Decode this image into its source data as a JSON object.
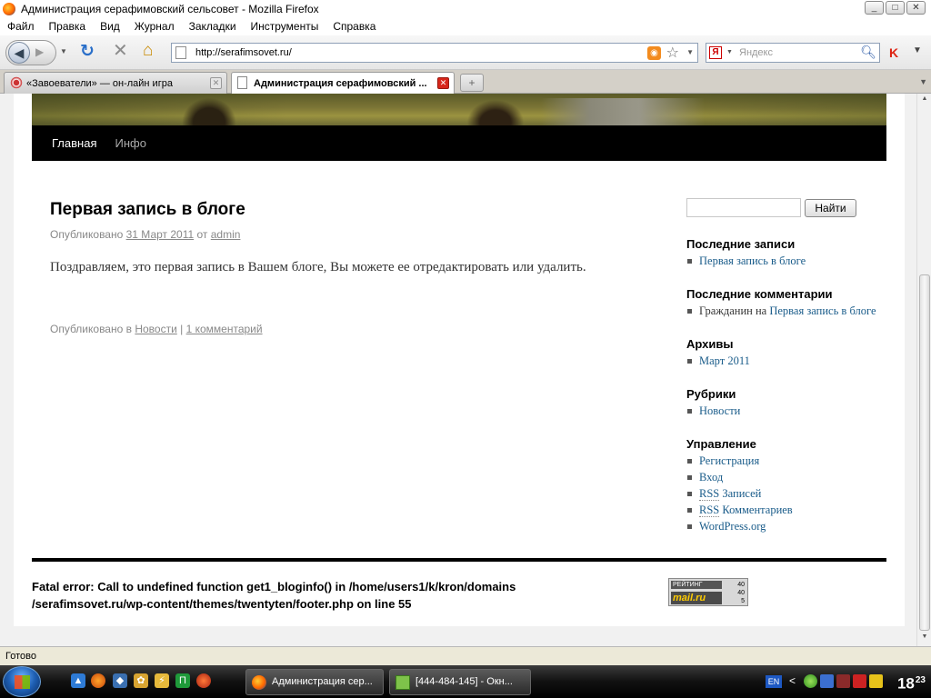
{
  "window": {
    "title": "Администрация серафимовский сельсовет - Mozilla Firefox",
    "controls": [
      "_",
      "□",
      "✕"
    ]
  },
  "menu": [
    "Файл",
    "Правка",
    "Вид",
    "Журнал",
    "Закладки",
    "Инструменты",
    "Справка"
  ],
  "nav": {
    "url": "http://serafimsovet.ru/",
    "search_placeholder": "Яндекс",
    "search_engine_badge": "Я"
  },
  "tabs": [
    {
      "label": "«Завоеватели» — он-лайн игра",
      "active": false
    },
    {
      "label": "Администрация серафимовский ...",
      "active": true
    }
  ],
  "site": {
    "menu": [
      "Главная",
      "Инфо"
    ]
  },
  "post": {
    "title": "Первая запись в блоге",
    "meta_prefix": "Опубликовано",
    "date": "31 Март 2011",
    "meta_by": "от",
    "author": "admin",
    "body": "Поздравляем, это первая запись в Вашем блоге, Вы можете ее отредактировать или удалить.",
    "foot_prefix": "Опубликовано в",
    "category": "Новости",
    "separator": "|",
    "comments": "1 комментарий"
  },
  "sidebar": {
    "search_button": "Найти",
    "recent_posts": {
      "title": "Последние записи",
      "items": [
        "Первая запись в блоге"
      ]
    },
    "recent_comments": {
      "title": "Последние комментарии",
      "author": "Гражданин",
      "on": "на",
      "link": "Первая запись в блоге"
    },
    "archives": {
      "title": "Архивы",
      "items": [
        "Март 2011"
      ]
    },
    "categories": {
      "title": "Рубрики",
      "items": [
        "Новости"
      ]
    },
    "meta": {
      "title": "Управление",
      "items": [
        "Регистрация",
        "Вход",
        "Записей",
        "Комментариев",
        "WordPress.org"
      ],
      "rss_abbr": "RSS"
    }
  },
  "footer": {
    "error": "Fatal error: Call to undefined function get1_bloginfo() in /home/users1/k/kron/domains /serafimsovet.ru/wp-content/themes/twentyten/footer.php on line 55",
    "counter": {
      "label": "РЕЙТИНГ",
      "logo": "mail.ru",
      "n1": "40",
      "n2": "40",
      "n3": "5"
    }
  },
  "status": "Готово",
  "taskbar": {
    "tasks": [
      "Администрация сер...",
      "[444-484-145] - Окн..."
    ],
    "lang": "EN",
    "time": "18",
    "time_min": "23"
  }
}
